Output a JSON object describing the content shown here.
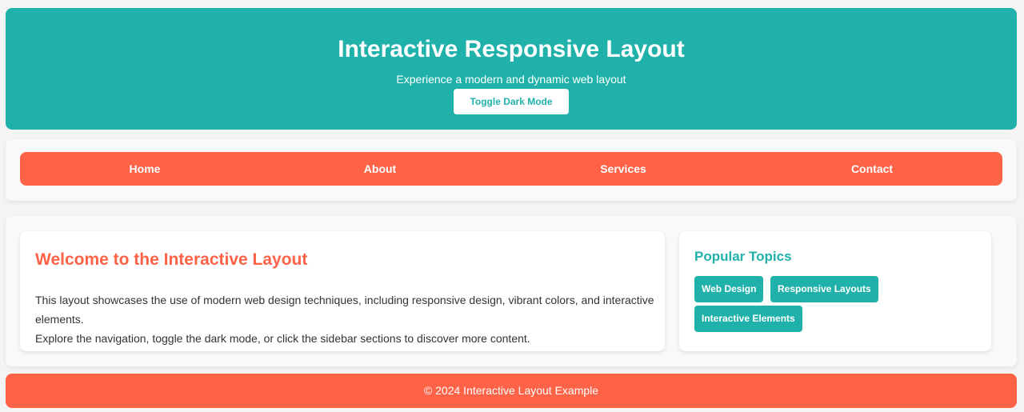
{
  "header": {
    "title": "Interactive Responsive Layout",
    "subtitle": "Experience a modern and dynamic web layout",
    "toggle_label": "Toggle Dark Mode"
  },
  "nav": {
    "items": [
      {
        "label": "Home"
      },
      {
        "label": "About"
      },
      {
        "label": "Services"
      },
      {
        "label": "Contact"
      }
    ]
  },
  "content": {
    "heading": "Welcome to the Interactive Layout",
    "paragraph1": "This layout showcases the use of modern web design techniques, including responsive design, vibrant colors, and interactive elements.",
    "paragraph2": "Explore the navigation, toggle the dark mode, or click the sidebar sections to discover more content."
  },
  "sidebar": {
    "heading": "Popular Topics",
    "topics": [
      {
        "label": "Web Design"
      },
      {
        "label": "Responsive Layouts"
      },
      {
        "label": "Interactive Elements"
      }
    ]
  },
  "footer": {
    "text": "© 2024 Interactive Layout Example"
  },
  "colors": {
    "teal": "#20b2aa",
    "coral": "#ff6347",
    "background": "#f4f4f4",
    "card": "#ffffff"
  }
}
